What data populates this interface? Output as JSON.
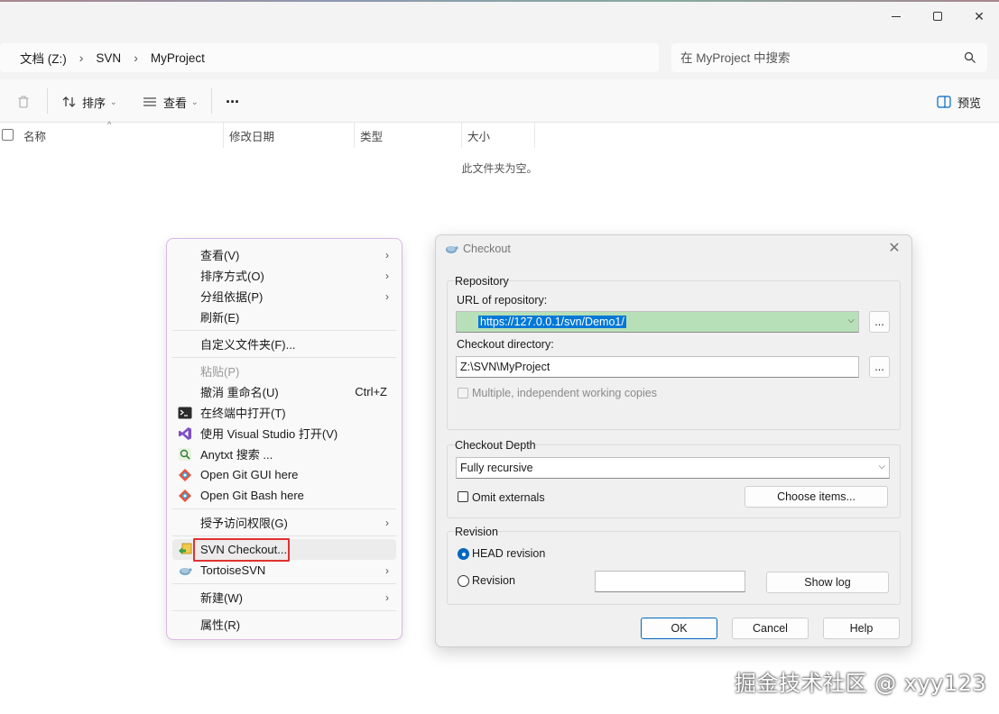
{
  "breadcrumb": [
    "文档 (Z:)",
    "SVN",
    "MyProject"
  ],
  "search": {
    "placeholder": "在 MyProject 中搜索"
  },
  "toolbar": {
    "sort_label": "排序",
    "view_label": "查看",
    "more_label": "···",
    "preview_label": "预览"
  },
  "columns": {
    "name": "名称",
    "modified": "修改日期",
    "type": "类型",
    "size": "大小"
  },
  "empty_message": "此文件夹为空。",
  "context_menu": {
    "items": [
      {
        "label": "查看(V)"
      },
      {
        "label": "排序方式(O)"
      },
      {
        "label": "分组依据(P)"
      },
      {
        "label": "刷新(E)"
      },
      {
        "label": "自定义文件夹(F)..."
      },
      {
        "label": "粘贴(P)"
      },
      {
        "label": "撤消 重命名(U)",
        "shortcut": "Ctrl+Z"
      },
      {
        "label": "在终端中打开(T)"
      },
      {
        "label": "使用 Visual Studio 打开(V)"
      },
      {
        "label": "Anytxt 搜索 ..."
      },
      {
        "label": "Open Git GUI here"
      },
      {
        "label": "Open Git Bash here"
      },
      {
        "label": "授予访问权限(G)"
      },
      {
        "label": "SVN Checkout..."
      },
      {
        "label": "TortoiseSVN"
      },
      {
        "label": "新建(W)"
      },
      {
        "label": "属性(R)"
      }
    ]
  },
  "dialog": {
    "title": "Checkout",
    "repository_group": "Repository",
    "url_label": "URL of repository:",
    "url_value": "https://127.0.0.1/svn/Demo1/",
    "dir_label": "Checkout directory:",
    "dir_value": "Z:\\SVN\\MyProject",
    "browse_label": "...",
    "multiple_label": "Multiple, independent working copies",
    "depth_group": "Checkout Depth",
    "depth_value": "Fully recursive",
    "omit_externals_label": "Omit externals",
    "choose_items_label": "Choose items...",
    "revision_group": "Revision",
    "head_revision_label": "HEAD revision",
    "revision_label": "Revision",
    "show_log_label": "Show log",
    "ok_label": "OK",
    "cancel_label": "Cancel",
    "help_label": "Help"
  },
  "watermark": "掘金技术社区 @ xyy123",
  "colors": {
    "accent": "#0067c0",
    "highlight_box": "#e03131",
    "url_bg": "#b8e0b8",
    "menu_border": "#d9b8e6"
  }
}
